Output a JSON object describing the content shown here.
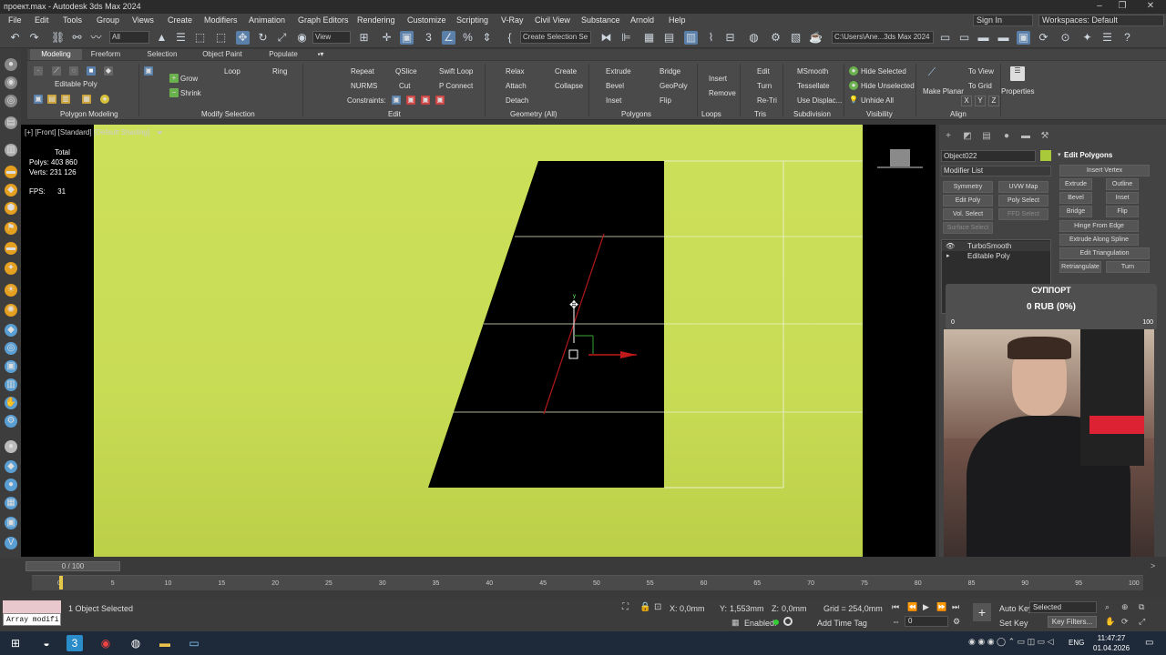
{
  "window": {
    "title": "проект.max - Autodesk 3ds Max 2024"
  },
  "menu": [
    "File",
    "Edit",
    "Tools",
    "Group",
    "Views",
    "Create",
    "Modifiers",
    "Animation",
    "Graph Editors",
    "Rendering",
    "Customize",
    "Scripting",
    "V-Ray",
    "Civil View",
    "Substance",
    "Arnold",
    "Help"
  ],
  "account": {
    "signin": "Sign In",
    "workspaces": "Workspaces: Default"
  },
  "toolbar": {
    "filter": "All",
    "view": "View",
    "selection_set": "Create Selection Se",
    "path": "C:\\Users\\Ane...3ds Max 2024"
  },
  "ribbon_tabs": [
    "Modeling",
    "Freeform",
    "Selection",
    "Object Paint",
    "Populate"
  ],
  "ribbon": {
    "editable_poly": "Editable Poly",
    "polygon_modeling": "Polygon Modeling",
    "grow": "Grow",
    "shrink": "Shrink",
    "loop": "Loop",
    "ring": "Ring",
    "modify_selection": "Modify Selection",
    "repeat": "Repeat",
    "qslice": "QSlice",
    "swift_loop": "Swift Loop",
    "nurms": "NURMS",
    "cut": "Cut",
    "pconnect": "P Connect",
    "constraints": "Constraints:",
    "edit": "Edit",
    "relax": "Relax",
    "create": "Create",
    "attach": "Attach",
    "collapse": "Collapse",
    "detach": "Detach",
    "geometry_all": "Geometry (All)",
    "extrude": "Extrude",
    "bridge": "Bridge",
    "bevel": "Bevel",
    "geopoly": "GeoPoly",
    "inset": "Inset",
    "flip": "Flip",
    "polygons": "Polygons",
    "insert": "Insert",
    "remove": "Remove",
    "loops": "Loops",
    "tris_edit": "Edit",
    "turn": "Turn",
    "retri": "Re-Tri",
    "tris": "Tris",
    "msmooth": "MSmooth",
    "tessellate": "Tessellate",
    "use_displac": "Use Displac...",
    "subdivision": "Subdivision",
    "hide_selected": "Hide Selected",
    "hide_unselected": "Hide Unselected",
    "unhide_all": "Unhide All",
    "visibility": "Visibility",
    "make_planar": "Make Planar",
    "to_view": "To View",
    "to_grid": "To Grid",
    "x": "X",
    "y": "Y",
    "z": "Z",
    "align": "Align",
    "properties": "Properties"
  },
  "viewport": {
    "label": "[+] [Front] [Standard] [Default Shading]",
    "total": "Total",
    "polys_label": "Polys:",
    "polys": "403 860",
    "verts_label": "Verts:",
    "verts": "231 126",
    "fps_label": "FPS:",
    "fps": "31",
    "gizmo_y": "y",
    "axis_z": "z",
    "axis_x": "x"
  },
  "command_panel": {
    "object_name": "Object022",
    "modifier_list": "Modifier List",
    "mod_buttons": [
      "Symmetry",
      "UVW Map",
      "Edit Poly",
      "Poly Select",
      "Vol. Select",
      "FFD Select",
      "Surface Select"
    ],
    "stack": [
      "TurboSmooth",
      "Editable Poly"
    ],
    "edit_polygons_title": "Edit Polygons",
    "ep": {
      "insert_vertex": "Insert Vertex",
      "extrude": "Extrude",
      "outline": "Outline",
      "bevel": "Bevel",
      "inset": "Inset",
      "bridge": "Bridge",
      "flip": "Flip",
      "hinge": "Hinge From Edge",
      "extrude_spline": "Extrude Along Spline",
      "edit_tri": "Edit Triangulation",
      "retriangulate": "Retriangulate",
      "turn": "Turn"
    }
  },
  "support": {
    "title": "СУППОРТ",
    "value": "0 RUB (0%)",
    "min": "0",
    "max": "100",
    "progress": 0
  },
  "timeline": {
    "frame": "0 / 100",
    "ticks": [
      "0",
      "5",
      "10",
      "15",
      "20",
      "25",
      "30",
      "35",
      "40",
      "45",
      "50",
      "55",
      "60",
      "65",
      "70",
      "75",
      "80",
      "85",
      "90",
      "95",
      "100"
    ]
  },
  "status": {
    "script": "Array modifi",
    "selected": "1 Object Selected",
    "x_label": "X:",
    "x": "0,0mm",
    "y_label": "Y:",
    "y": "1,553mm",
    "z_label": "Z:",
    "z": "0,0mm",
    "grid": "Grid = 254,0mm",
    "enabled": "Enabled:",
    "add_time_tag": "Add Time Tag",
    "auto_key": "Auto Key",
    "selected_dd": "Selected",
    "set_key": "Set Key",
    "key_filters": "Key Filters...",
    "frame_value": "0"
  },
  "taskbar": {
    "lang": "ENG",
    "time": "11:47:27",
    "date": "01.04.2026"
  }
}
